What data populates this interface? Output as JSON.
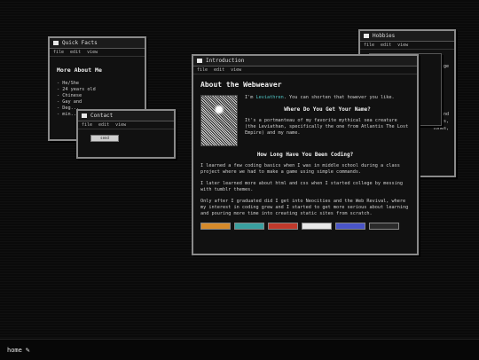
{
  "windows": {
    "hobbies": {
      "title": "Hobbies",
      "menu": [
        "file",
        "edit",
        "view"
      ],
      "visible_fragments": [
        "ge",
        "and",
        "ations,",
        "tones,"
      ]
    },
    "quick_facts": {
      "title": "Quick Facts",
      "menu": [
        "file",
        "edit",
        "view"
      ],
      "heading": "More About Me",
      "items": [
        "He/She",
        "24 years old",
        "Chinese",
        "Gay and",
        "Deg...",
        "min..."
      ]
    },
    "contact": {
      "title": "Contact",
      "menu": [
        "file",
        "edit",
        "view"
      ],
      "button_label": "send"
    },
    "intro": {
      "title": "Introduction",
      "menu": [
        "file",
        "edit",
        "view"
      ],
      "heading": "About the Webweaver",
      "intro_prefix": "I'm ",
      "name_link": "Leviathren",
      "intro_suffix": ". You can shorten that however you like.",
      "q1": "Where Do You Get Your Name?",
      "a1": "It's a portmanteau of my favorite mythical sea creature (the Leviathan, specifically the one from Atlantis The Lost Empire) and my name.",
      "q2": "How Long Have You Been Coding?",
      "p1": "I learned a few coding basics when I was in middle school during a class project where we had to make a game using simple commands.",
      "p2": "I later learned more about html and css when I started college by messing with tumblr themes.",
      "p3": "Only after I graduated did I get into Neocities and the Web Revival, where my interest in coding grew and I started to get more serious about learning and pouring more time into creating static sites from scratch.",
      "badges": [
        {
          "label": "",
          "color": "#d68a2a"
        },
        {
          "label": "",
          "color": "#3aa0a0"
        },
        {
          "label": "",
          "color": "#c0392b"
        },
        {
          "label": "",
          "color": "#e8e8e8"
        },
        {
          "label": "",
          "color": "#4a55c8"
        },
        {
          "label": "",
          "color": "#2a2a2a"
        }
      ]
    }
  },
  "taskbar": {
    "home_label": "home",
    "cursor_glyph": "✎"
  }
}
